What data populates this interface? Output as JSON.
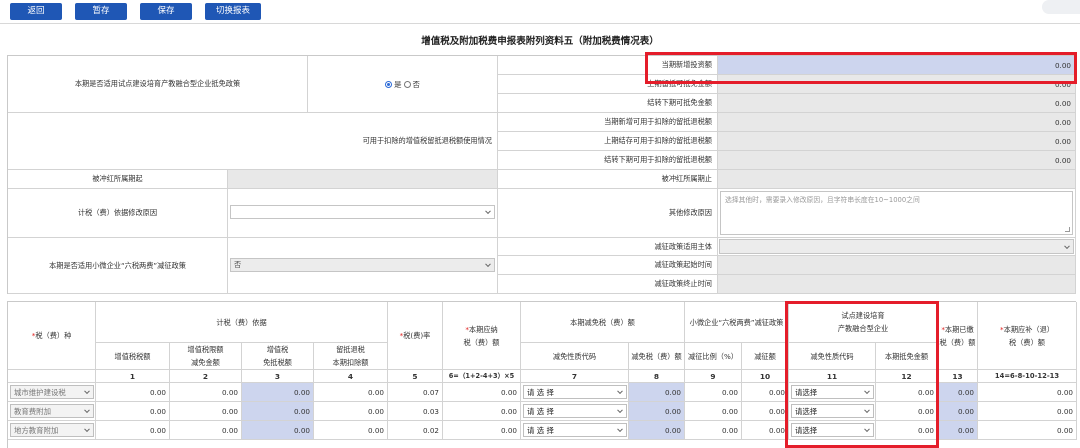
{
  "toolbar": {
    "back": "返回",
    "save_draft": "暂存",
    "save": "保存",
    "switch": "切换报表"
  },
  "title": "增值税及附加税费申报表附列资料五（附加税费情况表）",
  "upper": {
    "policy_label": "本期是否适用试点建设培育产教融合型企业抵免政策",
    "policy_yes": "是",
    "policy_no": "否",
    "new_invest_label": "当期新增投资额",
    "new_invest_value": "0.00",
    "prev_carry_label": "上期留抵可抵免金额",
    "prev_carry_value": "0.00",
    "next_carry_label": "结转下期可抵免金额",
    "next_carry_value": "0.00",
    "refund_usage_label": "可用于扣除的增值税留抵退税额使用情况",
    "refund_new_label": "当期新增可用于扣除的留抵退税额",
    "refund_new_value": "0.00",
    "refund_prev_label": "上期结存可用于扣除的留抵退税额",
    "refund_prev_value": "0.00",
    "refund_next_label": "结转下期可用于扣除的留抵退税额",
    "refund_next_value": "0.00",
    "redflush_start_label": "被冲红所属期起",
    "redflush_end_label": "被冲红所属期止",
    "basis_reason_label": "计税（费）依据修改原因",
    "other_reason_label": "其他修改原因",
    "other_reason_placeholder": "选择其他时，需要录入修改原因，且字符串长度在10~1000之间",
    "small_policy_label": "本期是否适用小微企业“六税两费”减征政策",
    "small_policy_value": "否",
    "reduce_subject_label": "减征政策适用主体",
    "reduce_start_label": "减征政策起始时间",
    "reduce_end_label": "减征政策终止时间"
  },
  "lower": {
    "col_tax_type": "税（费）种",
    "grp_basis": "计税（费）依据",
    "col_vat": "增值税税额",
    "col_vat_exempt_a": "增值税限额",
    "col_vat_exempt_b": "减免金额",
    "col_vat_free_a": "增值税",
    "col_vat_free_b": "免抵税额",
    "col_refund_a": "留抵退税",
    "col_refund_b": "本期扣除额",
    "col_rate": "税(费)率",
    "col_payable_a": "本期应纳",
    "col_payable_b": "税（费）额",
    "grp_reduction": "本期减免税（费）额",
    "col_reduce_code": "减免性质代码",
    "col_reduce_amt": "减免税（费）额",
    "grp_small": "小微企业“六税两费”减征政策",
    "col_small_ratio": "减征比例（%）",
    "col_small_amt": "减征额",
    "grp_pilot_a": "试点建设培育",
    "grp_pilot_b": "产教融合型企业",
    "col_pilot_code": "减免性质代码",
    "col_pilot_amt": "本期抵免金额",
    "col_paid_a": "本期已缴",
    "col_paid_b": "税（费）额",
    "col_supp_a": "本期应补（退）",
    "col_supp_b": "税（费）额",
    "nums": [
      "1",
      "2",
      "3",
      "4",
      "5",
      "6=（1+2-4+3）×5",
      "7",
      "8",
      "9",
      "10",
      "11",
      "12",
      "13",
      "14=6-8-10-12-13"
    ],
    "select_placeholder": "请 选 择",
    "select_placeholder2": "请选择",
    "rows": [
      {
        "name": "城市维护建设税",
        "c1": "0.00",
        "c2": "0.00",
        "c3": "0.00",
        "c4": "0.00",
        "c5": "0.07",
        "c6": "0.00",
        "c8": "0.00",
        "c9": "0.00",
        "c10": "0.00",
        "c12": "0.00",
        "c13": "0.00",
        "c14": "0.00"
      },
      {
        "name": "教育费附加",
        "c1": "0.00",
        "c2": "0.00",
        "c3": "0.00",
        "c4": "0.00",
        "c5": "0.03",
        "c6": "0.00",
        "c8": "0.00",
        "c9": "0.00",
        "c10": "0.00",
        "c12": "0.00",
        "c13": "0.00",
        "c14": "0.00"
      },
      {
        "name": "地方教育附加",
        "c1": "0.00",
        "c2": "0.00",
        "c3": "0.00",
        "c4": "0.00",
        "c5": "0.02",
        "c6": "0.00",
        "c8": "0.00",
        "c9": "0.00",
        "c10": "0.00",
        "c12": "0.00",
        "c13": "0.00",
        "c14": "0.00"
      }
    ]
  },
  "colors": {
    "accent": "#1f57b5",
    "highlight": "#e41d2a",
    "input_blue": "#cdd5ee"
  }
}
